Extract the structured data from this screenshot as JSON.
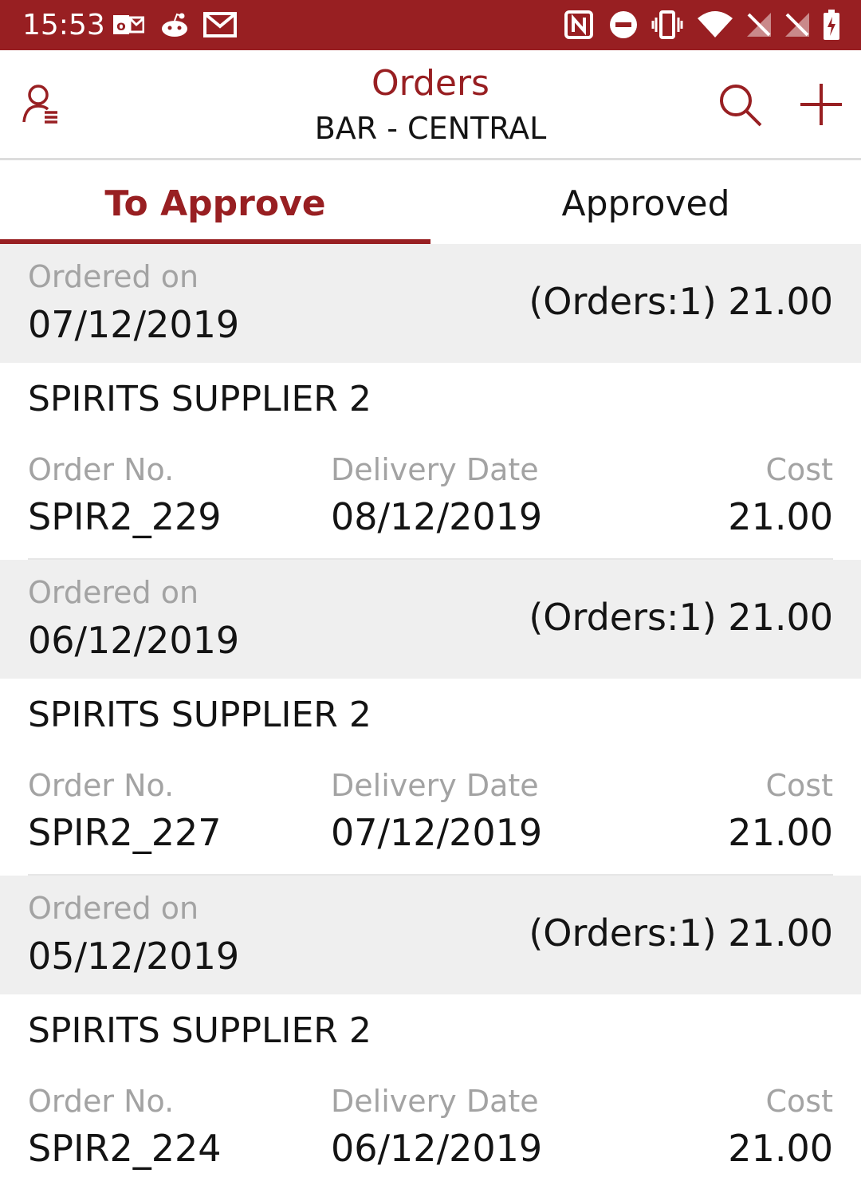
{
  "status_bar": {
    "time": "15:53",
    "icons": [
      "outlook-icon",
      "reddit-icon",
      "gmail-icon",
      "nfc-icon",
      "do-not-disturb-icon",
      "vibrate-icon",
      "wifi-icon",
      "no-signal-icon",
      "no-signal-icon",
      "battery-charging-icon"
    ]
  },
  "header": {
    "title": "Orders",
    "subtitle": "BAR - CENTRAL",
    "left_icon": "user-menu-icon",
    "right_icons": [
      "search-icon",
      "plus-icon"
    ]
  },
  "tabs": [
    {
      "label": "To Approve",
      "active": true
    },
    {
      "label": "Approved",
      "active": false
    }
  ],
  "groups": [
    {
      "label": "Ordered on",
      "date": "07/12/2019",
      "total": "(Orders:1) 21.00",
      "orders": [
        {
          "supplier": "SPIRITS SUPPLIER 2",
          "order_no_label": "Order No.",
          "order_no": "SPIR2_229",
          "delivery_label": "Delivery Date",
          "delivery_date": "08/12/2019",
          "cost_label": "Cost",
          "cost": "21.00"
        }
      ]
    },
    {
      "label": "Ordered on",
      "date": "06/12/2019",
      "total": "(Orders:1) 21.00",
      "orders": [
        {
          "supplier": "SPIRITS SUPPLIER 2",
          "order_no_label": "Order No.",
          "order_no": "SPIR2_227",
          "delivery_label": "Delivery Date",
          "delivery_date": "07/12/2019",
          "cost_label": "Cost",
          "cost": "21.00"
        }
      ]
    },
    {
      "label": "Ordered on",
      "date": "05/12/2019",
      "total": "(Orders:1) 21.00",
      "orders": [
        {
          "supplier": "SPIRITS SUPPLIER 2",
          "order_no_label": "Order No.",
          "order_no": "SPIR2_224",
          "delivery_label": "Delivery Date",
          "delivery_date": "06/12/2019",
          "cost_label": "Cost",
          "cost": "21.00"
        }
      ]
    }
  ],
  "colors": {
    "accent": "#981f22",
    "text": "#141414",
    "muted": "#a3a3a3",
    "header_bg": "#efefef"
  }
}
